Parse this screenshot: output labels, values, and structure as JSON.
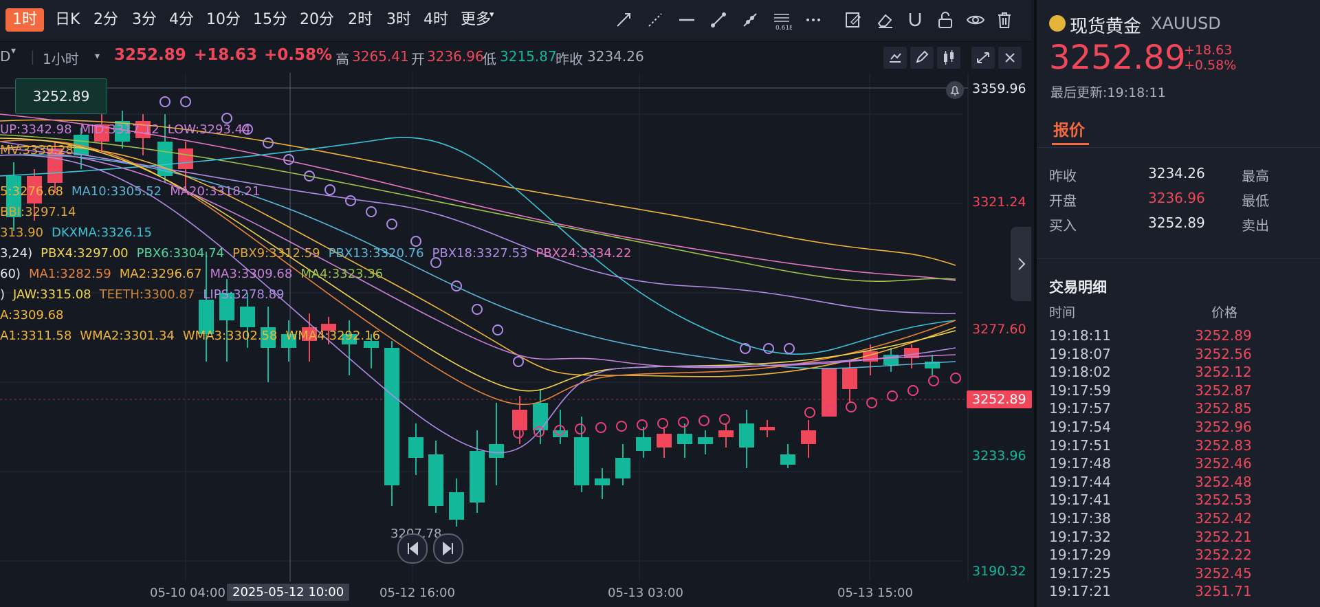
{
  "periods": [
    "1时",
    "日K",
    "2分",
    "3分",
    "4分",
    "10分",
    "15分",
    "20分",
    "2时",
    "3时",
    "4时",
    "更多"
  ],
  "tools": [
    "trend-line-icon",
    "ray-line-icon",
    "horizontal-line-icon",
    "segment-icon",
    "extend-line-icon",
    "fibonacci-icon",
    "more-dots-icon",
    "edit-note-icon",
    "eraser-icon",
    "magnet-icon",
    "unlock-icon",
    "eye-icon",
    "trash-icon"
  ],
  "fib_label": "0.618",
  "info": {
    "symbol_partial": "D",
    "interval": "1小时",
    "price": "3252.89",
    "change": "+18.63",
    "change_pct": "+0.58%",
    "high_label": "高",
    "high": "3265.41",
    "open_label": "开",
    "open": "3236.96",
    "low_label": "低",
    "low": "3215.87",
    "prev_label": "昨收",
    "prev": "3234.26"
  },
  "price_axis": [
    "3359.96",
    "3321.24",
    "3277.60",
    "3252.89",
    "3233.96",
    "3190.32"
  ],
  "current_price_box": "3252.89",
  "indicators": [
    [
      {
        "t": "UP:3342.98",
        "c": "#c97fd6"
      },
      {
        "t": "MID:3317.12",
        "c": "#c97fd6"
      },
      {
        "t": "LOW:3293.44",
        "c": "#c97fd6"
      }
    ],
    [
      {
        "t": "MV:3339.28",
        "c": "#e0a63a"
      }
    ],
    [
      {
        "t": "5:3276.68",
        "c": "#f0b53a"
      },
      {
        "t": "MA10:3305.52",
        "c": "#5ab5d6"
      },
      {
        "t": "MA20:3318.21",
        "c": "#c97fd6"
      }
    ],
    [
      {
        "t": "BBI:3297.14",
        "c": "#e0a63a"
      }
    ],
    [
      {
        "t": "313.90",
        "c": "#e0a63a"
      },
      {
        "t": "DKXMA:3326.15",
        "c": "#3bc4d6"
      }
    ],
    [
      {
        "t": "3,24)",
        "c": "#e8eaee"
      },
      {
        "t": "PBX4:3297.00",
        "c": "#f2d54a"
      },
      {
        "t": "PBX6:3304.74",
        "c": "#52d6a0"
      },
      {
        "t": "PBX9:3312.59",
        "c": "#e0a63a"
      },
      {
        "t": "PBX13:3320.76",
        "c": "#5ab5d6"
      },
      {
        "t": "PBX18:3327.53",
        "c": "#b08be6"
      },
      {
        "t": "PBX24:3334.22",
        "c": "#e676c0"
      }
    ],
    [
      {
        "t": "60)",
        "c": "#e8eaee"
      },
      {
        "t": "MA1:3282.59",
        "c": "#e8833a"
      },
      {
        "t": "MA2:3296.67",
        "c": "#f0b53a"
      },
      {
        "t": "MA3:3309.68",
        "c": "#c97fd6"
      },
      {
        "t": "MA4:3323.36",
        "c": "#9bc24a"
      }
    ],
    [
      {
        "t": ")",
        "c": "#e8eaee"
      },
      {
        "t": "JAW:3315.08",
        "c": "#f2d54a"
      },
      {
        "t": "TEETH:3300.87",
        "c": "#d0853a"
      },
      {
        "t": "LIPS:3278.89",
        "c": "#b08be6"
      }
    ],
    [
      {
        "t": "A:3309.68",
        "c": "#f0b53a"
      }
    ],
    [
      {
        "t": "A1:3311.58",
        "c": "#f0b53a"
      },
      {
        "t": "WMA2:3301.34",
        "c": "#f0b53a"
      },
      {
        "t": "WMA3:3302.58",
        "c": "#f0b53a"
      },
      {
        "t": "WMA4:3292.16",
        "c": "#f0b53a"
      }
    ]
  ],
  "low_annotation": "3207.78",
  "time_axis": [
    "05-10 04:00",
    "2025-05-12 10:00",
    "05-12 16:00",
    "05-13 03:00",
    "05-13 15:00"
  ],
  "panel": {
    "title": "现货黄金",
    "code": "XAUUSD",
    "price": "3252.89",
    "change": "+18.63",
    "change_pct": "+0.58%",
    "update": "最后更新:19:18:11",
    "tab": "报价",
    "quote": [
      {
        "k": "昨收",
        "v": "3234.26",
        "vc": "#e8eaee",
        "k2": "最高"
      },
      {
        "k": "开盘",
        "v": "3236.96",
        "vc": "#f0485a",
        "k2": "最低"
      },
      {
        "k": "买入",
        "v": "3252.89",
        "vc": "#e8eaee",
        "k2": "卖出"
      }
    ],
    "deal_title": "交易明细",
    "deal_time": "时间",
    "deal_price": "价格",
    "deals": [
      [
        "19:18:11",
        "3252.89"
      ],
      [
        "19:18:07",
        "3252.56"
      ],
      [
        "19:18:02",
        "3252.12"
      ],
      [
        "19:17:59",
        "3252.87"
      ],
      [
        "19:17:57",
        "3252.85"
      ],
      [
        "19:17:54",
        "3252.96"
      ],
      [
        "19:17:51",
        "3252.83"
      ],
      [
        "19:17:48",
        "3252.46"
      ],
      [
        "19:17:44",
        "3252.48"
      ],
      [
        "19:17:41",
        "3252.53"
      ],
      [
        "19:17:38",
        "3252.42"
      ],
      [
        "19:17:32",
        "3252.21"
      ],
      [
        "19:17:29",
        "3252.22"
      ],
      [
        "19:17:25",
        "3252.45"
      ],
      [
        "19:17:21",
        "3251.71"
      ]
    ]
  }
}
